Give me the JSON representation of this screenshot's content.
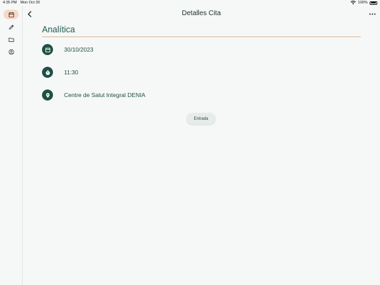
{
  "status_bar": {
    "time": "4:35 PM",
    "date": "Mon Oct 30",
    "battery": "100%"
  },
  "sidebar": {
    "items": [
      {
        "icon": "calendar-icon",
        "active": true
      },
      {
        "icon": "pencil-icon",
        "active": false
      },
      {
        "icon": "folder-icon",
        "active": false
      },
      {
        "icon": "profile-icon",
        "active": false
      }
    ]
  },
  "header": {
    "title": "Detalles Cita"
  },
  "appointment": {
    "title": "Analítica",
    "date": "30/10/2023",
    "time": "11:30",
    "location": "Centre de Salut Integral DENIA"
  },
  "actions": {
    "entrada_label": "Entrada"
  },
  "colors": {
    "accent": "#1e5046",
    "active_nav": "#f7d9c9",
    "title_underline": "#d8b79e"
  }
}
